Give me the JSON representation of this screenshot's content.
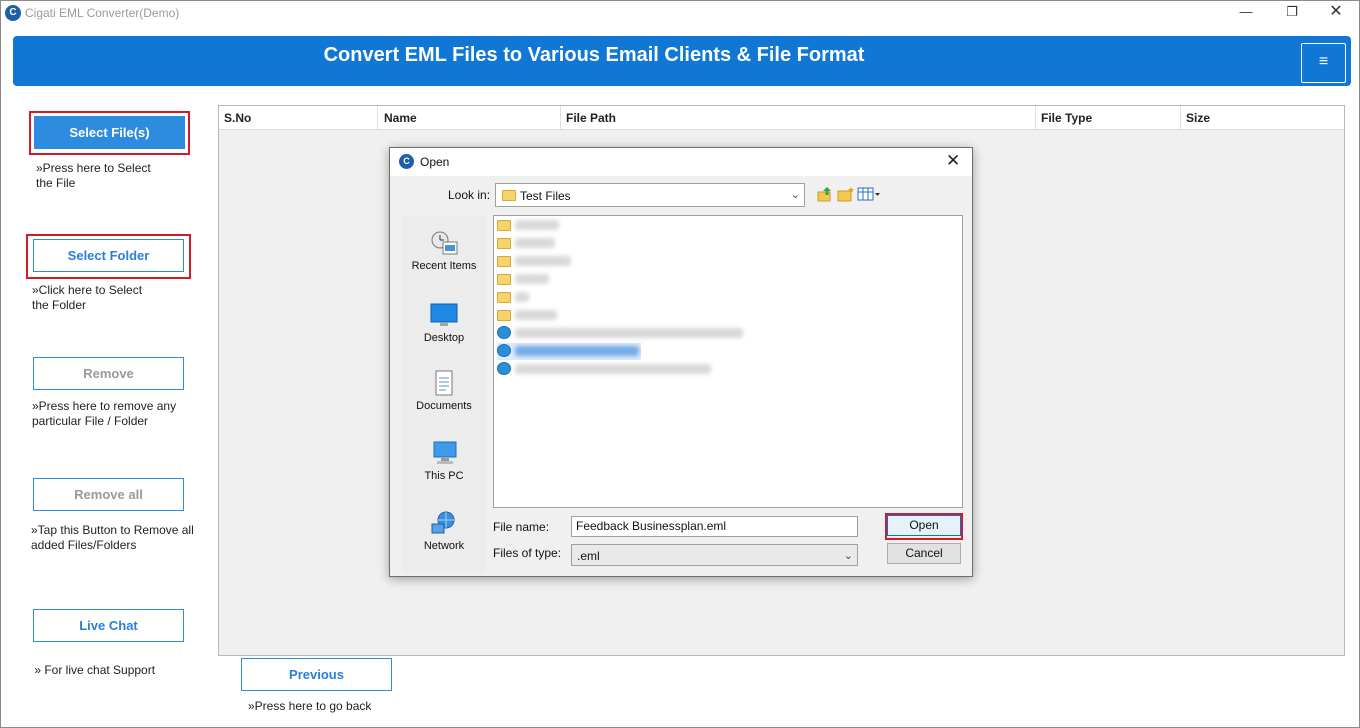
{
  "window": {
    "title": "Cigati EML Converter(Demo)",
    "icon": "cigati-logo-icon",
    "controls": {
      "minimize": "—",
      "maximize": "❐",
      "close": "✕"
    }
  },
  "header": {
    "heading": "Convert EML Files to Various Email Clients & File Format",
    "menu_glyph": "≡",
    "accent_color": "#1078d4"
  },
  "sidebar": {
    "select_files": {
      "label": "Select File(s)",
      "hint_line1": "»Press here to Select",
      "hint_line2": "the File"
    },
    "select_folder": {
      "label": "Select Folder",
      "hint_line1": "»Click here to Select",
      "hint_line2": "the Folder"
    },
    "remove": {
      "label": "Remove",
      "hint_line1": "»Press here to remove any",
      "hint_line2": "particular File / Folder"
    },
    "remove_all": {
      "label": "Remove all",
      "hint_line1": "»Tap this Button to Remove all",
      "hint_line2": "added Files/Folders"
    },
    "live_chat": {
      "label": "Live Chat",
      "hint_line1": " » For live chat Support"
    }
  },
  "table": {
    "columns": [
      "S.No",
      "Name",
      "File Path",
      "File Type",
      "Size"
    ]
  },
  "footer": {
    "previous_label": "Previous",
    "previous_hint": "»Press here to go back"
  },
  "dialog": {
    "title": "Open",
    "close_glyph": "✕",
    "look_in_label": "Look in:",
    "look_in_value": "Test Files",
    "places": [
      {
        "label": "Recent Items",
        "icon": "recent-items-icon"
      },
      {
        "label": "Desktop",
        "icon": "desktop-icon"
      },
      {
        "label": "Documents",
        "icon": "documents-icon"
      },
      {
        "label": "This PC",
        "icon": "this-pc-icon"
      },
      {
        "label": "Network",
        "icon": "network-icon"
      }
    ],
    "file_name_label": "File name:",
    "file_name_value": "Feedback Businessplan.eml",
    "file_type_label": "Files of type:",
    "file_type_value": ".eml",
    "open_label": "Open",
    "cancel_label": "Cancel",
    "highlight_color": "#d11a2a"
  }
}
